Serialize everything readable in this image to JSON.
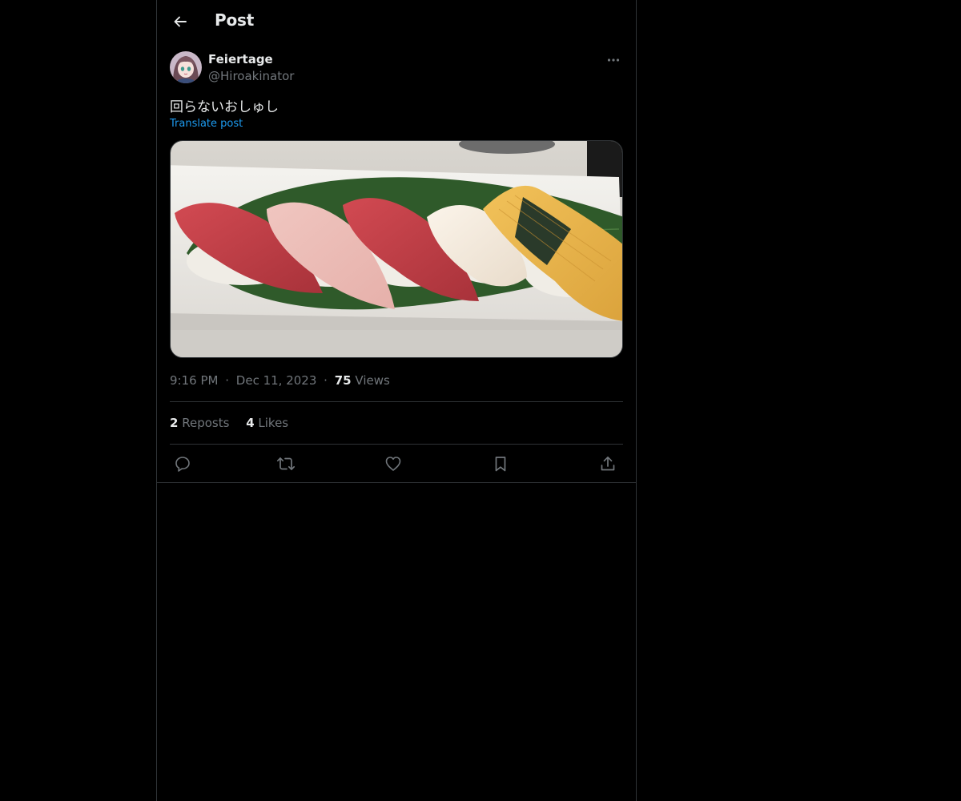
{
  "header": {
    "title": "Post",
    "back_icon": "arrow-left-icon"
  },
  "author": {
    "display_name": "Feiertage",
    "handle": "@Hiroakinator",
    "avatar_icon": "avatar-anime-girl"
  },
  "post": {
    "text": "回らないおしゅし",
    "translate_label": "Translate post",
    "media_description_icon": "sushi-platter-photo"
  },
  "meta": {
    "time": "9:16 PM",
    "separator": "·",
    "date": "Dec 11, 2023",
    "views_count": "75",
    "views_label": "Views"
  },
  "stats": {
    "reposts_count": "2",
    "reposts_label": "Reposts",
    "likes_count": "4",
    "likes_label": "Likes"
  },
  "actions": {
    "reply_icon": "reply-icon",
    "repost_icon": "repost-icon",
    "like_icon": "heart-icon",
    "bookmark_icon": "bookmark-icon",
    "share_icon": "share-icon"
  },
  "colors": {
    "background": "#000000",
    "text_primary": "#e7e9ea",
    "text_secondary": "#71767b",
    "accent": "#1d9bf0",
    "border": "#2f3336"
  }
}
